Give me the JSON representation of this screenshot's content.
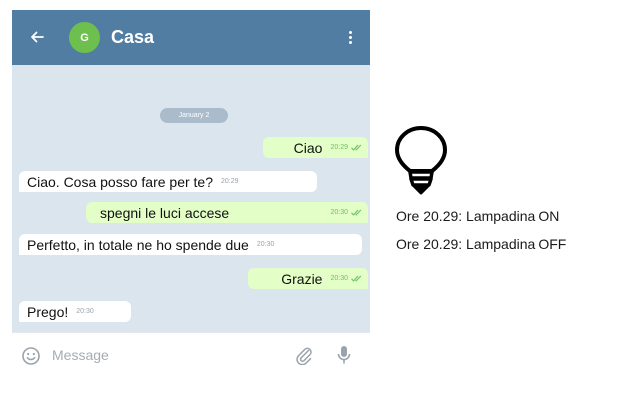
{
  "header": {
    "avatar_initial": "G",
    "chat_title": "Casa"
  },
  "date_divider": "January 2",
  "messages": [
    {
      "direction": "out",
      "text": "Ciao",
      "time": "20:29",
      "read": true
    },
    {
      "direction": "in",
      "text": "Ciao. Cosa posso fare per te?",
      "time": "20:29"
    },
    {
      "direction": "out",
      "text": "spegni le luci accese",
      "time": "20:30",
      "read": true
    },
    {
      "direction": "in",
      "text": "Perfetto, in totale ne ho spende due",
      "time": "20:30"
    },
    {
      "direction": "out",
      "text": "Grazie",
      "time": "20:30",
      "read": true
    },
    {
      "direction": "in",
      "text": "Prego!",
      "time": "20:30"
    }
  ],
  "composer": {
    "placeholder": "Message"
  },
  "icons": {
    "back": "arrow-left-icon",
    "menu": "kebab-menu-icon",
    "emoji": "smile-icon",
    "attach": "paperclip-icon",
    "mic": "microphone-icon",
    "bulb": "light-bulb-icon"
  },
  "colors": {
    "topbar": "#517da2",
    "chat_background": "#dbe5ee",
    "outgoing_bubble": "#e3fec6",
    "incoming_bubble": "#ffffff",
    "avatar": "#6ec04e",
    "read_check": "#6fbf68"
  },
  "log": [
    {
      "prefix": "Ore 20.29: Lampadina",
      "state": "ON"
    },
    {
      "prefix": "Ore 20.29: Lampadina",
      "state": "OFF"
    }
  ]
}
